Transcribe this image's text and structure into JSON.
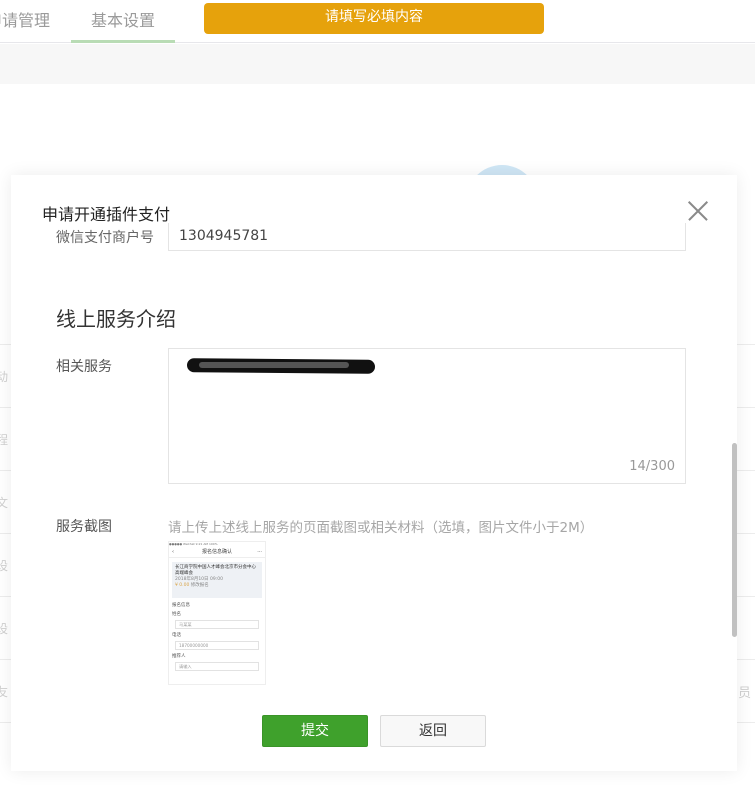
{
  "background": {
    "tabs": [
      {
        "label": "申请管理"
      },
      {
        "label": "基本设置"
      }
    ],
    "left_fragments": [
      "动",
      "程",
      "文",
      "设",
      "设",
      "友"
    ],
    "right_fragment": "员"
  },
  "toast": {
    "message": "请填写必填内容"
  },
  "modal": {
    "title": "申请开通插件支付",
    "previous_field": {
      "label": "微信支付商户号",
      "value": "1304945781"
    },
    "section_title": "线上服务介绍",
    "related_service": {
      "label": "相关服务",
      "char_count": "14/300"
    },
    "screenshot": {
      "label": "服务截图",
      "hint": "请上传上述线上服务的页面截图或相关材料（选填，图片文件小于2M）",
      "thumbnail": {
        "nav_title": "报名信息确认",
        "status_left": "●●●●● WeChat",
        "status_time": "9:21 AM",
        "status_right": "100%",
        "card_title": "长江商学院中国人才峰会北京市分会中心 高端峰会",
        "card_date": "2018年8月10日 09:00",
        "card_price": "¥ 0.00",
        "card_action": "修改报名",
        "section_label": "报名信息",
        "fields": [
          {
            "label": "姓名",
            "value": "马某某"
          },
          {
            "label": "电话",
            "value": "18700000000"
          },
          {
            "label": "推荐人",
            "value": "请输入"
          }
        ]
      }
    },
    "buttons": {
      "submit": "提交",
      "back": "返回"
    }
  }
}
